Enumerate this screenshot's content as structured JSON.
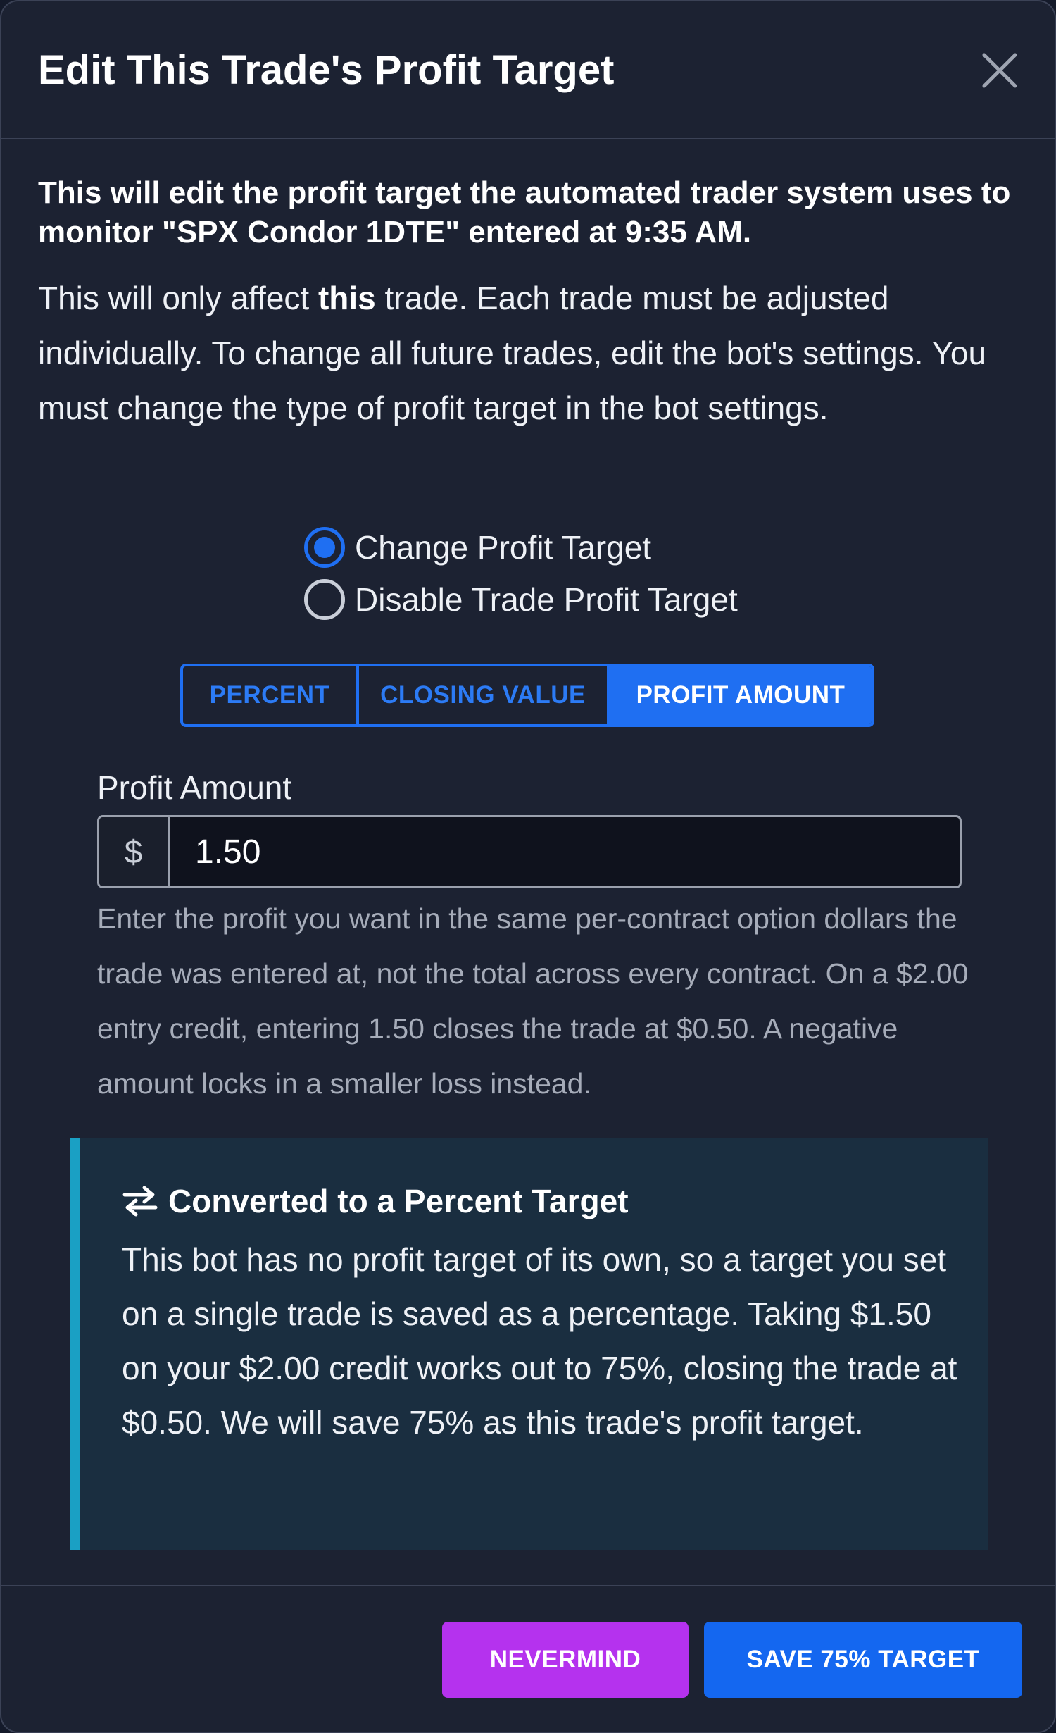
{
  "dialog": {
    "title": "Edit This Trade's Profit Target",
    "close_icon": "close-icon"
  },
  "intro": {
    "lead": "This will edit the profit target the automated trader system uses to monitor \"SPX Condor 1DTE\" entered at 9:35 AM.",
    "info_before": "This will only affect ",
    "info_bold": "this",
    "info_after": " trade. Each trade must be adjusted individually. To change all future trades, edit the bot's settings. You must change the type of profit target in the bot settings."
  },
  "mode_options": [
    {
      "label": "Change Profit Target",
      "checked": true
    },
    {
      "label": "Disable Trade Profit Target",
      "checked": false
    }
  ],
  "target_types": [
    {
      "label": "PERCENT",
      "active": false
    },
    {
      "label": "CLOSING VALUE",
      "active": false
    },
    {
      "label": "PROFIT AMOUNT",
      "active": true
    }
  ],
  "profit_amount": {
    "label": "Profit Amount",
    "prefix": "$",
    "value": "1.50",
    "help": "Enter the profit you want in the same per-contract option dollars the trade was entered at, not the total across every contract. On a $2.00 entry credit, entering 1.50 closes the trade at $0.50. A negative amount locks in a smaller loss instead."
  },
  "callout": {
    "icon": "swap-arrows-icon",
    "title": "Converted to a Percent Target",
    "body": "This bot has no profit target of its own, so a target you set on a single trade is saved as a percentage. Taking $1.50 on your $2.00 credit works out to 75%, closing the trade at $0.50. We will save 75% as this trade's profit target."
  },
  "footer": {
    "cancel_label": "NEVERMIND",
    "save_label": "SAVE 75% TARGET"
  },
  "colors": {
    "accent_blue": "#1f6ff2",
    "nevermind_purple": "#b532ee",
    "callout_border": "#1aa0c4",
    "background": "#1c2232"
  }
}
